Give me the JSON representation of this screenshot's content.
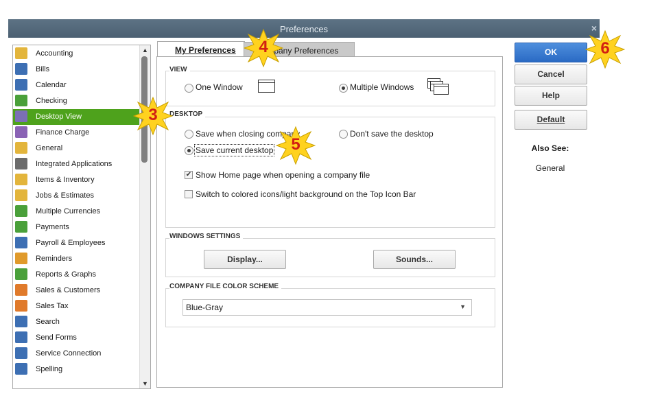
{
  "window": {
    "title": "Preferences",
    "close": "×"
  },
  "sidebar": {
    "items": [
      {
        "label": "Accounting",
        "icon": "accounting-icon",
        "color": "#e3b53c"
      },
      {
        "label": "Bills",
        "icon": "bills-icon",
        "color": "#3d6fb3"
      },
      {
        "label": "Calendar",
        "icon": "calendar-icon",
        "color": "#3d6fb3"
      },
      {
        "label": "Checking",
        "icon": "checking-icon",
        "color": "#4aa03a"
      },
      {
        "label": "Desktop View",
        "icon": "desktop-view-icon",
        "color": "#7b6fb5"
      },
      {
        "label": "Finance Charge",
        "icon": "finance-charge-icon",
        "color": "#8a63b5"
      },
      {
        "label": "General",
        "icon": "general-icon",
        "color": "#e3b53c"
      },
      {
        "label": "Integrated Applications",
        "icon": "integrated-applications-icon",
        "color": "#6b6b6b"
      },
      {
        "label": "Items & Inventory",
        "icon": "items-inventory-icon",
        "color": "#e3b53c"
      },
      {
        "label": "Jobs & Estimates",
        "icon": "jobs-estimates-icon",
        "color": "#e3b53c"
      },
      {
        "label": "Multiple Currencies",
        "icon": "multiple-currencies-icon",
        "color": "#4aa03a"
      },
      {
        "label": "Payments",
        "icon": "payments-icon",
        "color": "#4aa03a"
      },
      {
        "label": "Payroll & Employees",
        "icon": "payroll-employees-icon",
        "color": "#3d6fb3"
      },
      {
        "label": "Reminders",
        "icon": "reminders-icon",
        "color": "#e09a2b"
      },
      {
        "label": "Reports & Graphs",
        "icon": "reports-graphs-icon",
        "color": "#4aa03a"
      },
      {
        "label": "Sales & Customers",
        "icon": "sales-customers-icon",
        "color": "#e07a2b"
      },
      {
        "label": "Sales Tax",
        "icon": "sales-tax-icon",
        "color": "#e07a2b"
      },
      {
        "label": "Search",
        "icon": "search-icon",
        "color": "#3d6fb3"
      },
      {
        "label": "Send Forms",
        "icon": "send-forms-icon",
        "color": "#3d6fb3"
      },
      {
        "label": "Service Connection",
        "icon": "service-connection-icon",
        "color": "#3d6fb3"
      },
      {
        "label": "Spelling",
        "icon": "spelling-icon",
        "color": "#3d6fb3"
      }
    ],
    "selected": "Desktop View",
    "selected_color": "#4ea21c"
  },
  "tabs": {
    "my": "My Preferences",
    "company": "Company Preferences"
  },
  "view": {
    "heading": "VIEW",
    "one_window": "One Window",
    "multiple_windows": "Multiple Windows",
    "selected": "Multiple Windows"
  },
  "desktop": {
    "heading": "DESKTOP",
    "save_when_closing": "Save when closing company",
    "dont_save": "Don't save the desktop",
    "save_current": "Save current desktop",
    "selected": "Save current desktop",
    "show_home": "Show Home page when opening a company file",
    "show_home_checked": true,
    "colored_icons": "Switch to colored icons/light background on the Top Icon Bar",
    "colored_icons_checked": false
  },
  "windows_settings": {
    "heading": "WINDOWS SETTINGS",
    "display": "Display...",
    "sounds": "Sounds..."
  },
  "color_scheme": {
    "heading": "COMPANY FILE COLOR SCHEME",
    "value": "Blue-Gray"
  },
  "buttons": {
    "ok": "OK",
    "cancel": "Cancel",
    "help": "Help",
    "default": "Default"
  },
  "also_see": {
    "heading": "Also See:",
    "link": "General"
  },
  "callouts": [
    "3",
    "4",
    "5",
    "6"
  ],
  "colors": {
    "title_bar": "#526779",
    "ok_button": "#3a7bd0",
    "callout_fill": "#ffd21f",
    "callout_text": "#d21f12"
  }
}
